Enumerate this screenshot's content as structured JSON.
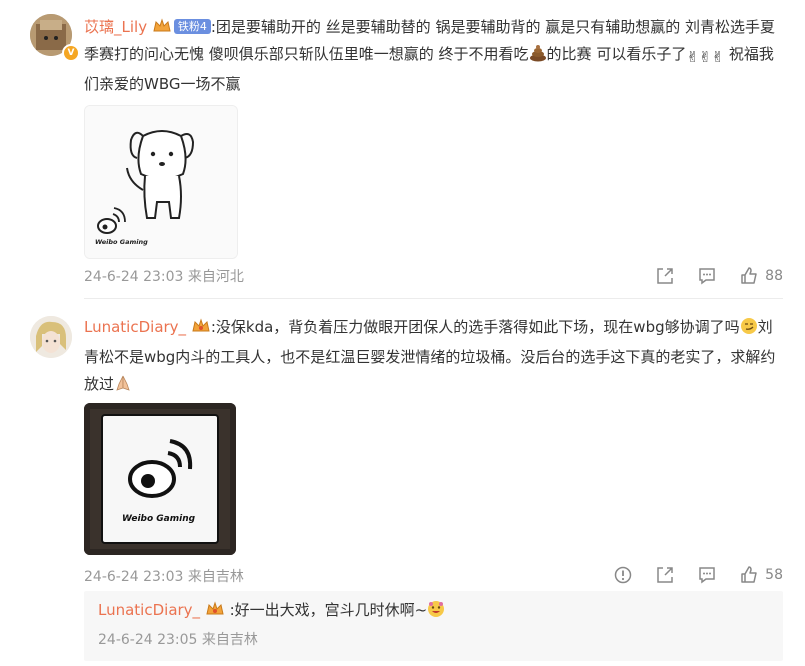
{
  "comments": [
    {
      "username": "苡璃_Lily",
      "fan_badge": "铁粉4",
      "text": ":团是要辅助开的  丝是要辅助替的 锅是要辅助背的  赢是只有辅助想赢的 刘青松选手夏季赛打的问心无愧   傻呗俱乐部只斩队伍里唯一想赢的 终于不用看吃",
      "text_after_emoji": "的比赛  可以看乐子了",
      "text_end": " 祝福我们亲爱的WBG一场不赢",
      "image_caption": "Weibo Gaming",
      "timestamp": "24-6-24 23:03",
      "location": "来自河北",
      "like_count": "88"
    },
    {
      "username": "LunaticDiary_",
      "text_part1": ":没保kda，背负着压力做眼开团保人的选手落得如此下场，现在wbg够协调了吗",
      "text_part2": "刘青松不是wbg内斗的工具人，也不是红温巨婴发泄情绪的垃圾桶。没后台的选手这下真的老实了，求解约放过",
      "image_caption": "Weibo Gaming",
      "timestamp": "24-6-24 23:03",
      "location": "来自吉林",
      "like_count": "58"
    }
  ],
  "reply": {
    "username": "LunaticDiary_",
    "text": ":好一出大戏，宫斗几时休啊~",
    "timestamp": "24-6-24 23:05",
    "location": "来自吉林"
  },
  "colors": {
    "username": "#eb7350",
    "meta": "#999999",
    "badge": "#6b8fe0"
  },
  "icons": [
    "crown-icon",
    "share-icon",
    "comment-icon",
    "like-icon",
    "report-icon",
    "victory-hand-emoji",
    "poop-emoji",
    "pray-emoji",
    "smirk-emoji"
  ]
}
